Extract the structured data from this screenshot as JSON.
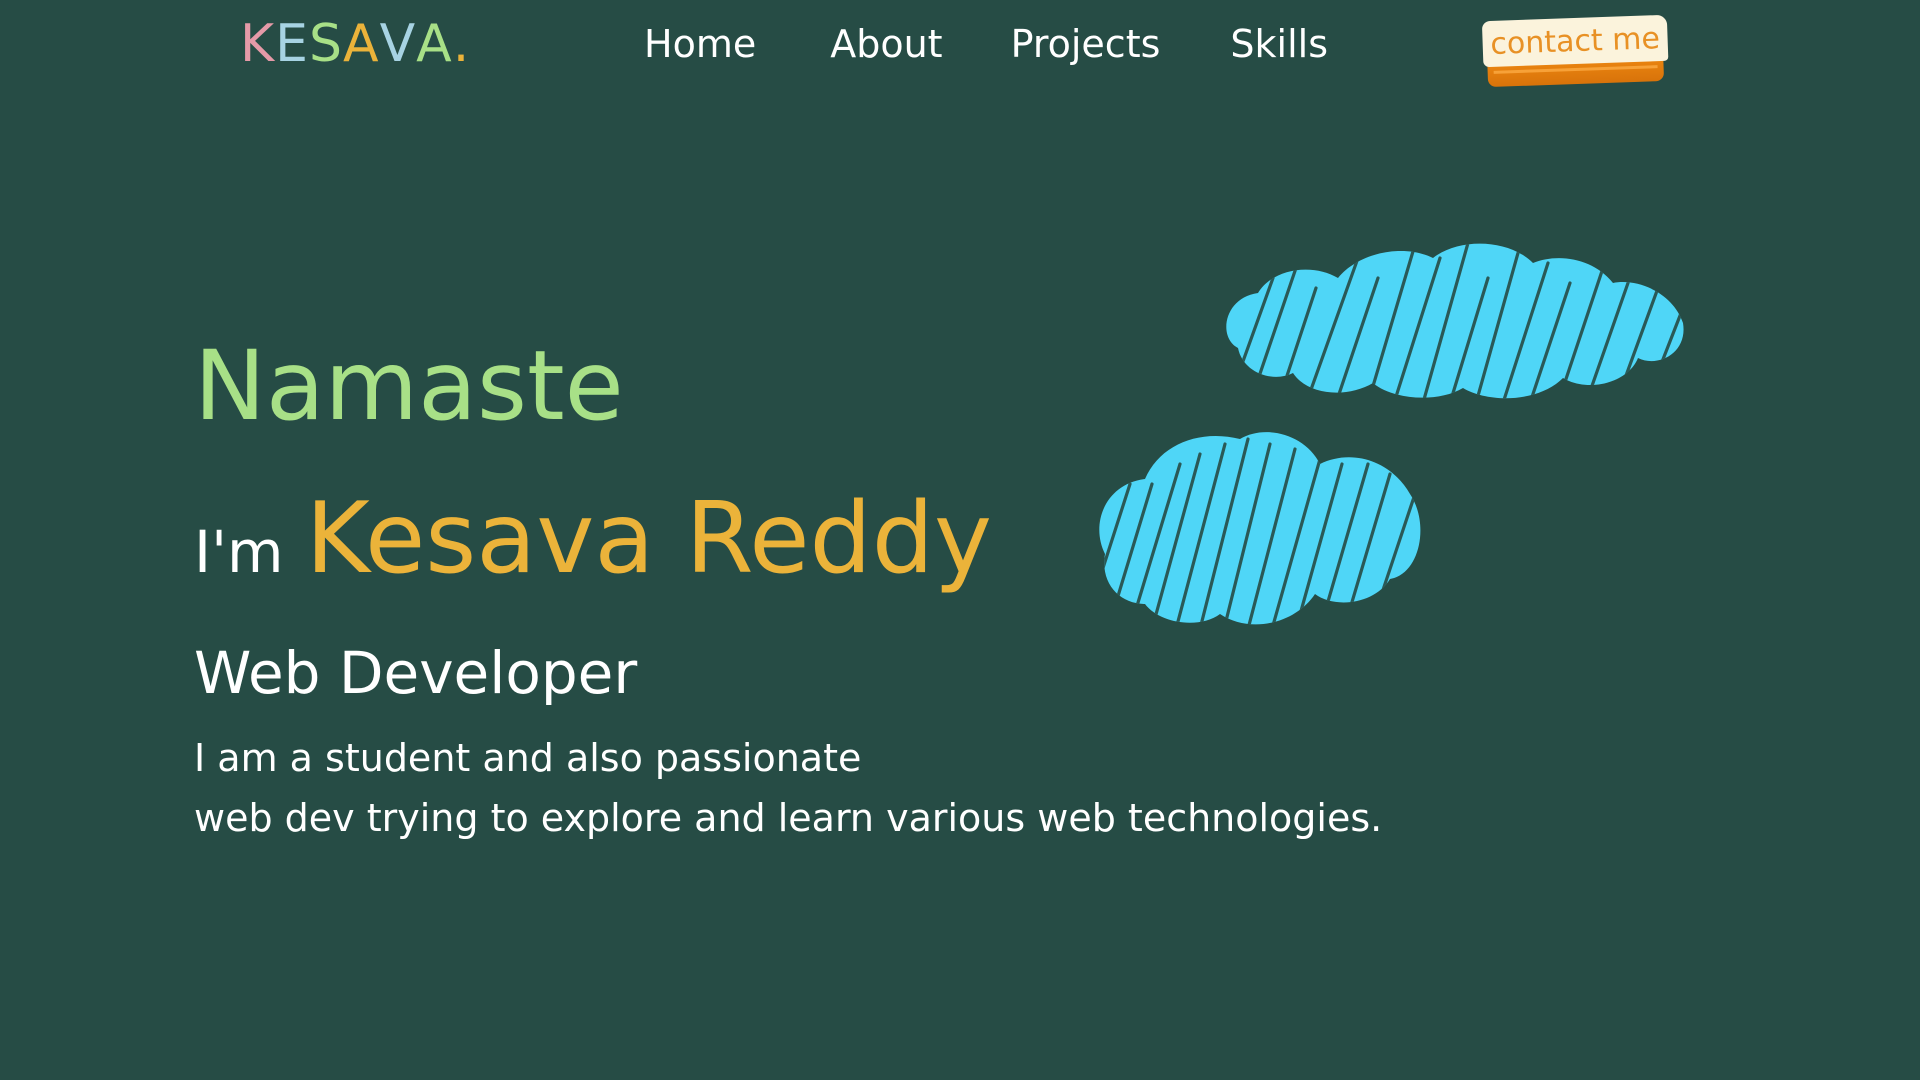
{
  "header": {
    "logo": {
      "letters": [
        {
          "char": "K",
          "color": "#e59aa8"
        },
        {
          "char": "E",
          "color": "#a7d3e3"
        },
        {
          "char": "S",
          "color": "#a8e087"
        },
        {
          "char": "A",
          "color": "#ebb33a"
        },
        {
          "char": "V",
          "color": "#a7d3e3"
        },
        {
          "char": "A",
          "color": "#a8e087"
        },
        {
          "char": ".",
          "color": "#ebb33a"
        }
      ]
    },
    "nav": {
      "home": "Home",
      "about": "About",
      "projects": "Projects",
      "skills": "Skills"
    },
    "contact_button": "contact me"
  },
  "hero": {
    "greeting": "Namaste",
    "intro_prefix": "I'm",
    "name": "Kesava Reddy",
    "role": "Web Developer",
    "bio_line1": "I am a student and also passionate",
    "bio_line2": "web dev trying to explore and learn various web technologies."
  },
  "decorations": {
    "cloud_icon": "cloud-icon",
    "cloud_color": "#4fd6f7"
  },
  "colors": {
    "background": "#264c45",
    "greeting": "#a8e087",
    "name": "#ebb33a",
    "button_face": "#fbf3dc",
    "button_base": "#f08a12",
    "button_text": "#e89125"
  }
}
